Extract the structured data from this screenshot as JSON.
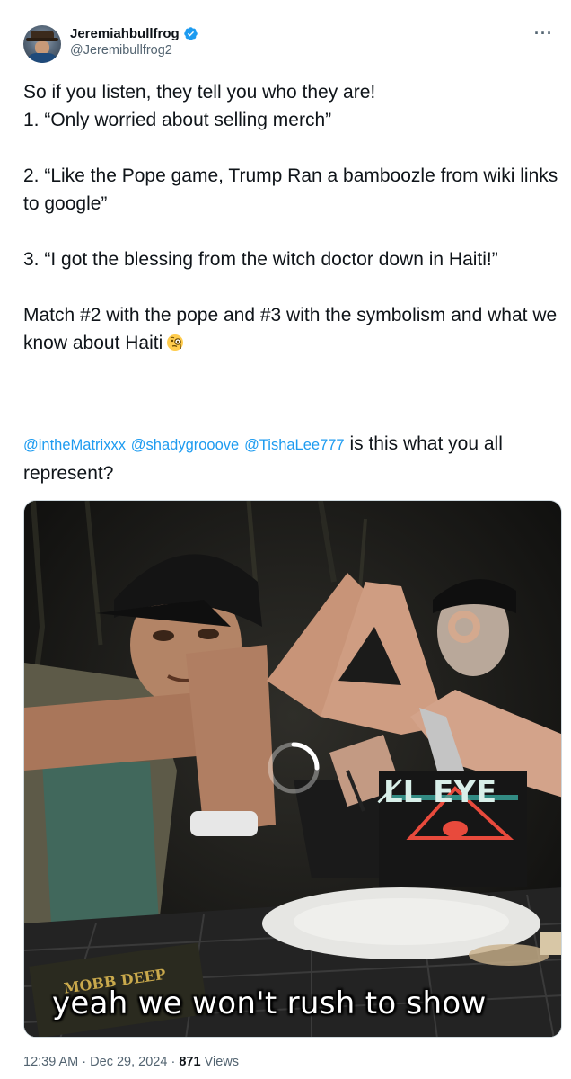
{
  "author": {
    "display_name": "Jeremiahbullfrog",
    "handle": "@Jeremibullfrog2",
    "verified_icon": "verified-badge-icon",
    "verified_color": "#1d9bf0"
  },
  "more_icon": "more-horizontal-icon",
  "tweet": {
    "paragraphs": [
      "So if you listen, they tell you who they are!\n1. “Only worried about selling merch”",
      "2. “Like the Pope game, Trump Ran a bamboozle from wiki links to google”",
      "3. “I got the blessing from the witch doctor down in Haiti!”",
      "Match #2 with the pope and #3 with the symbolism and what we know about Haiti"
    ],
    "emoji": "face-with-monocle-icon",
    "mentions": [
      "@intheMatrixxx",
      "@shadygrooove",
      "@TishaLee777"
    ],
    "mentions_suffix": " is this what you all represent?"
  },
  "media": {
    "caption": "yeah we won't rush to show",
    "loading_icon": "loading-spinner-icon",
    "tattoo_text": "L̸L EYE",
    "badge_text": "MOBB DEEP"
  },
  "meta": {
    "time": "12:39 AM",
    "date": "Dec 29, 2024",
    "views_count": "871",
    "views_label": "Views",
    "separator": "·"
  }
}
